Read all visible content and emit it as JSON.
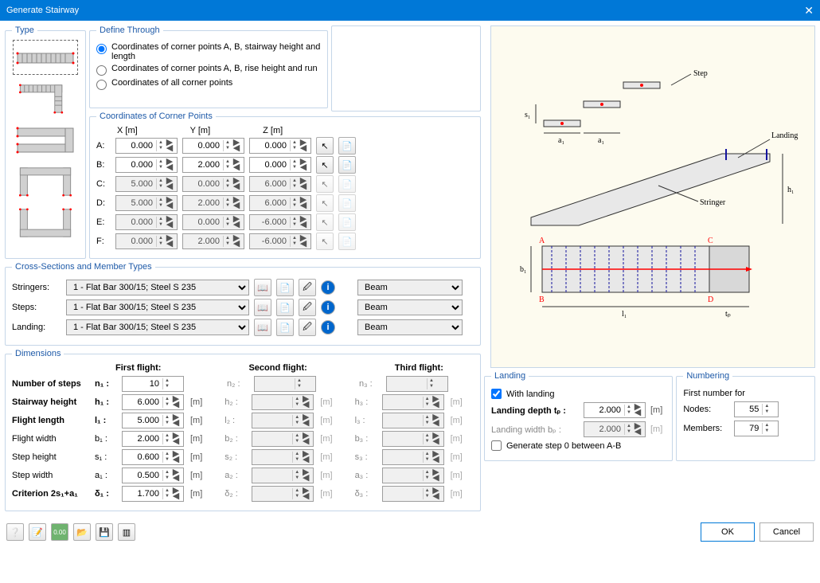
{
  "title": "Generate Stairway",
  "type_legend": "Type",
  "define": {
    "legend": "Define Through",
    "opt1": "Coordinates of corner points A, B, stairway height and length",
    "opt2": "Coordinates of corner points A, B, rise height and run",
    "opt3": "Coordinates of all corner points"
  },
  "coords": {
    "legend": "Coordinates of Corner Points",
    "x": "X  [m]",
    "y": "Y  [m]",
    "z": "Z  [m]",
    "rows": [
      {
        "label": "A:",
        "x": "0.000",
        "y": "0.000",
        "z": "0.000"
      },
      {
        "label": "B:",
        "x": "0.000",
        "y": "2.000",
        "z": "0.000"
      },
      {
        "label": "C:",
        "x": "5.000",
        "y": "0.000",
        "z": "6.000"
      },
      {
        "label": "D:",
        "x": "5.000",
        "y": "2.000",
        "z": "6.000"
      },
      {
        "label": "E:",
        "x": "0.000",
        "y": "0.000",
        "z": "-6.000"
      },
      {
        "label": "F:",
        "x": "0.000",
        "y": "2.000",
        "z": "-6.000"
      }
    ]
  },
  "cs": {
    "legend": "Cross-Sections and Member Types",
    "stringers": "Stringers:",
    "steps": "Steps:",
    "landing": "Landing:",
    "profile": "1 - Flat Bar 300/15; Steel S 235",
    "mtype": "Beam"
  },
  "dim": {
    "legend": "Dimensions",
    "f1": "First flight:",
    "f2": "Second flight:",
    "f3": "Third flight:",
    "nsteps": "Number of steps",
    "sheight": "Stairway height",
    "flength": "Flight length",
    "fwidth": "Flight width",
    "stepH": "Step height",
    "stepW": "Step width",
    "crit": "Criterion 2s₁+a₁",
    "n1": "n₁ :",
    "n2": "n₂ :",
    "n3": "n₃ :",
    "h1": "h₁ :",
    "h2": "h₂ :",
    "h3": "h₃ :",
    "l1": "l₁ :",
    "l2": "l₂ :",
    "l3": "l₃ :",
    "b1": "b₁ :",
    "b2": "b₂ :",
    "b3": "b₃ :",
    "s1": "s₁ :",
    "s2": "s₂ :",
    "s3": "s₃ :",
    "a1": "a₁ :",
    "a2": "a₂ :",
    "a3": "a₃ :",
    "d1": "δ₁ :",
    "d2": "δ₂ :",
    "d3": "δ₃ :",
    "v_n1": "10",
    "v_h1": "6.000",
    "v_l1": "5.000",
    "v_b1": "2.000",
    "v_s1": "0.600",
    "v_a1": "0.500",
    "v_d1": "1.700",
    "m": "[m]"
  },
  "landing": {
    "legend": "Landing",
    "with": "With landing",
    "depth": "Landing depth tₚ :",
    "width": "Landing width bₚ :",
    "gen0": "Generate step 0 between A-B",
    "v_depth": "2.000",
    "v_width": "2.000"
  },
  "numbering": {
    "legend": "Numbering",
    "first": "First number for",
    "nodes": "Nodes:",
    "members": "Members:",
    "v_nodes": "55",
    "v_members": "79"
  },
  "diagram": {
    "step": "Step",
    "landing": "Landing",
    "stringer": "Stringer",
    "A": "A",
    "B": "B",
    "C": "C",
    "D": "D",
    "s1": "s₁",
    "a1": "a₁",
    "b1": "b₁",
    "l1": "l₁",
    "h1": "h₁",
    "tp": "tₚ"
  },
  "buttons": {
    "ok": "OK",
    "cancel": "Cancel"
  }
}
